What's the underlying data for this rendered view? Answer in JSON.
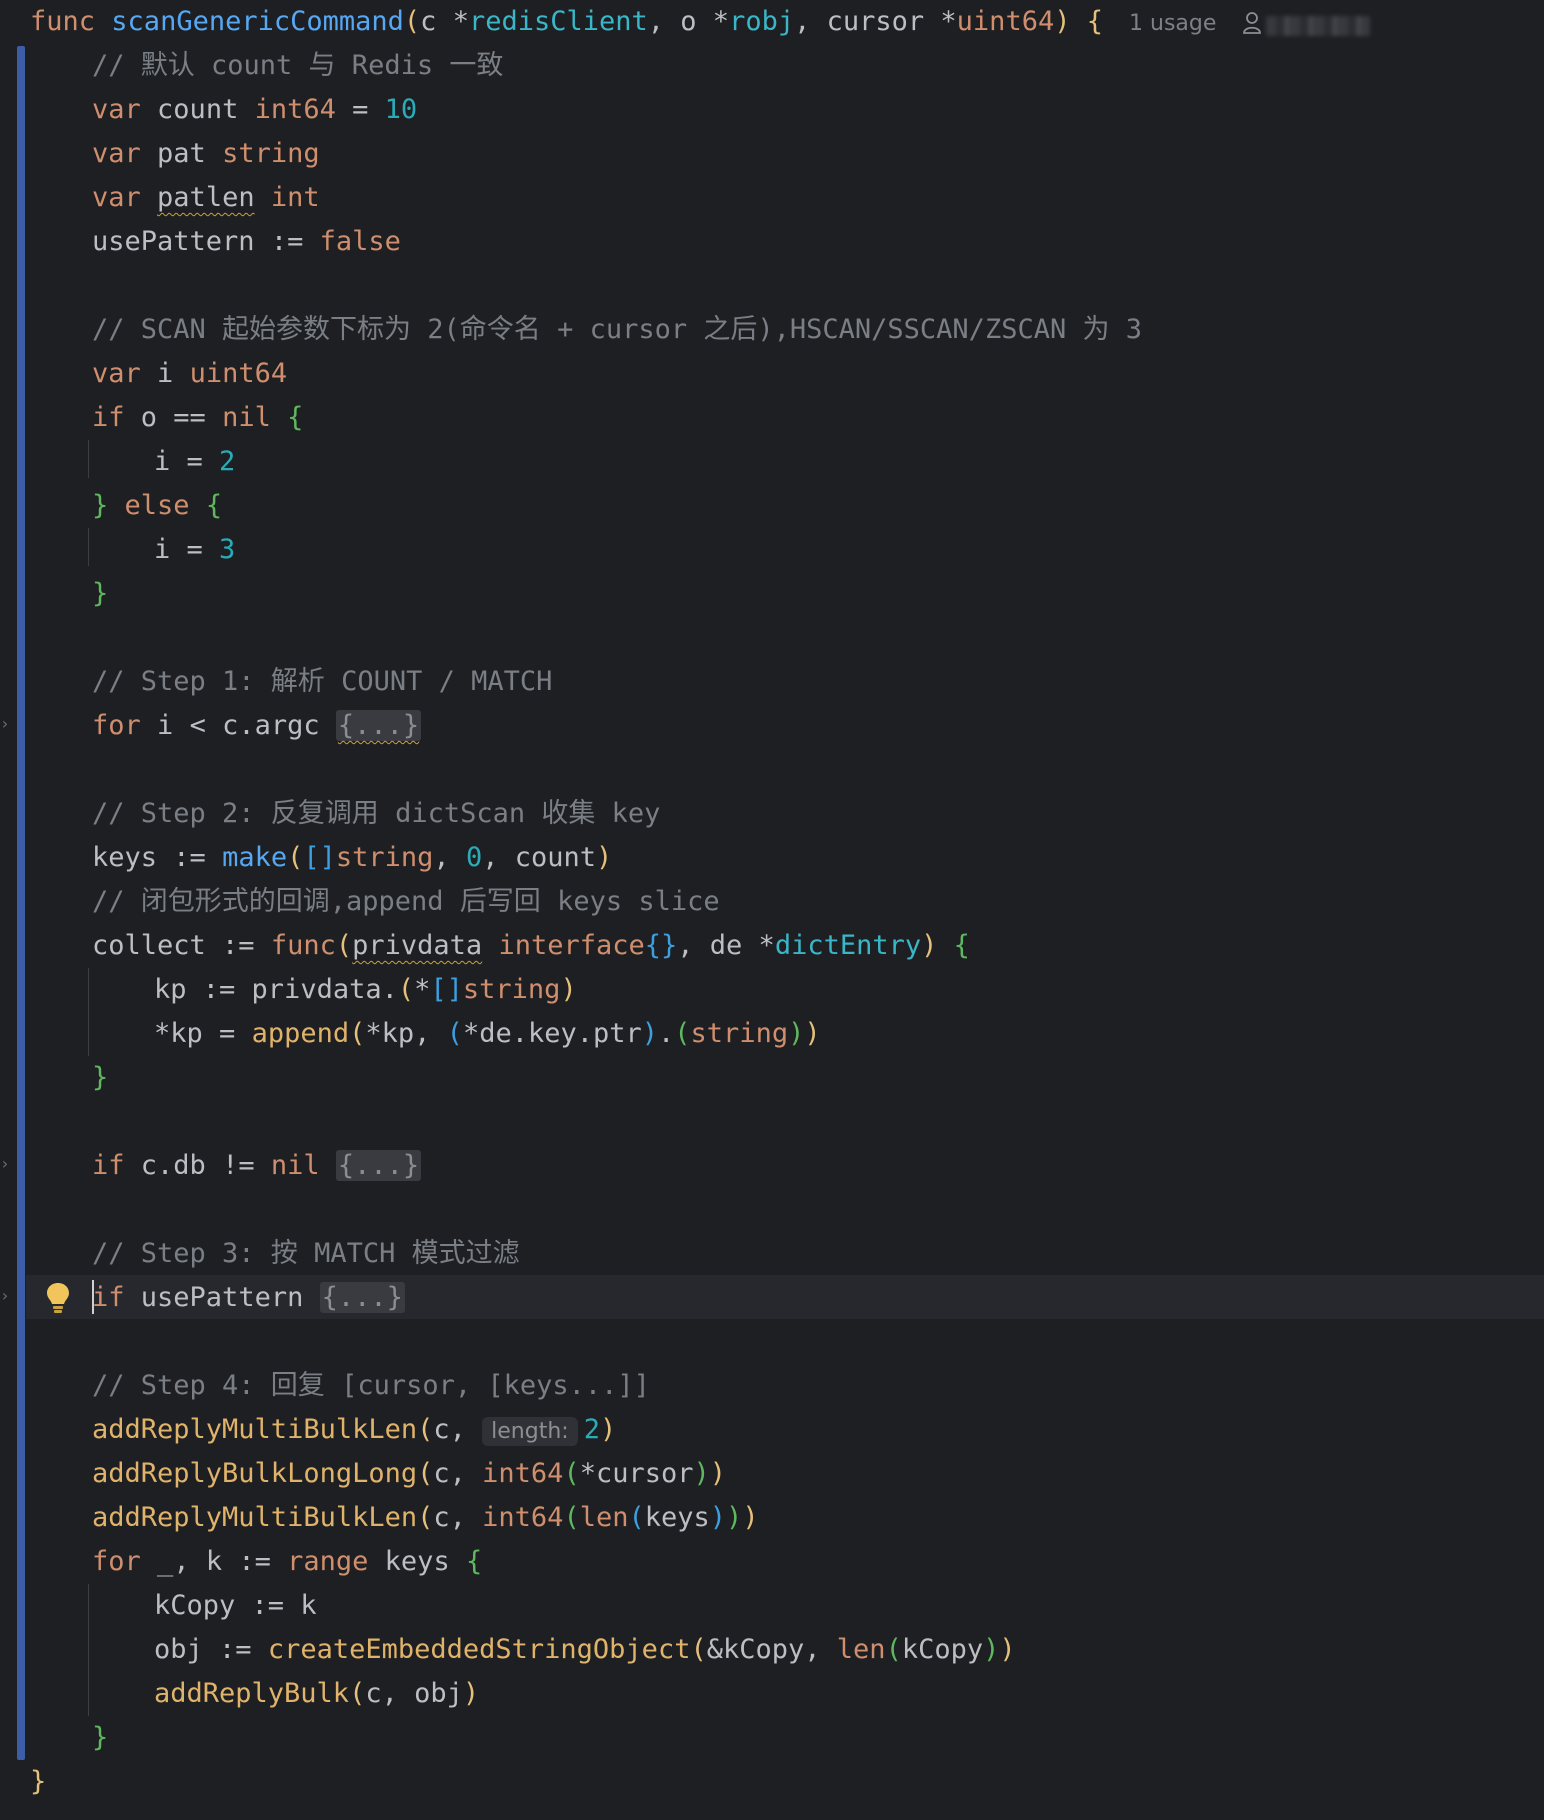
{
  "editor": {
    "language": "Go",
    "usage_hint": "1 usage",
    "author_icon": "person-icon",
    "bulb_icon": "lightbulb-icon",
    "param_hint": "length:",
    "colors": {
      "background": "#1e1f22",
      "keyword": "#cf8e6d",
      "function": "#56a8f5",
      "method": "#e0b36b",
      "number": "#2aacb8",
      "comment": "#7a7e85",
      "vcs_bar": "#3c5ea8"
    }
  },
  "code": {
    "l1": {
      "func": "func",
      "name": "scanGenericCommand",
      "p1": "c",
      "t1": "redisClient",
      "p2": "o",
      "t2": "robj",
      "p3": "cursor",
      "t3": "uint64"
    },
    "c1": "// 默认 count 与 Redis 一致",
    "c2": "// SCAN 起始参数下标为 2(命令名 + cursor 之后),HSCAN/SSCAN/ZSCAN 为 3",
    "c3": "// Step 1: 解析 COUNT / MATCH",
    "c4": "// Step 2: 反复调用 dictScan 收集 key",
    "c5": "// 闭包形式的回调,append 后写回 keys slice",
    "c6": "// Step 3: 按 MATCH 模式过滤",
    "c7": "// Step 4: 回复 [cursor, [keys...]]",
    "fold": "{...}",
    "kw": {
      "var": "var",
      "if": "if",
      "else": "else",
      "for": "for",
      "func": "func",
      "range": "range",
      "nil": "nil",
      "false": "false"
    },
    "types": {
      "int64": "int64",
      "string": "string",
      "int": "int",
      "uint64": "uint64",
      "interface": "interface",
      "dictEntry": "dictEntry"
    },
    "ids": {
      "count": "count",
      "pat": "pat",
      "patlen": "patlen",
      "usePattern": "usePattern",
      "i": "i",
      "o": "o",
      "c_argc": "c.argc",
      "keys": "keys",
      "collect": "collect",
      "privdata": "privdata",
      "de": "de",
      "kp": "kp",
      "de_key_ptr": "*de.key.ptr",
      "c_db": "c.db",
      "cursor": "*cursor",
      "k": "k",
      "kCopy": "kCopy",
      "amp_kCopy": "&kCopy",
      "obj": "obj",
      "underscore": "_",
      "c": "c"
    },
    "nums": {
      "ten": "10",
      "two": "2",
      "three": "3",
      "zero": "0"
    },
    "funcs": {
      "make": "make",
      "append": "append",
      "len": "len",
      "addReplyMultiBulkLen": "addReplyMultiBulkLen",
      "addReplyBulkLongLong": "addReplyBulkLongLong",
      "createEmbeddedStringObject": "createEmbeddedStringObject",
      "addReplyBulk": "addReplyBulk"
    }
  }
}
